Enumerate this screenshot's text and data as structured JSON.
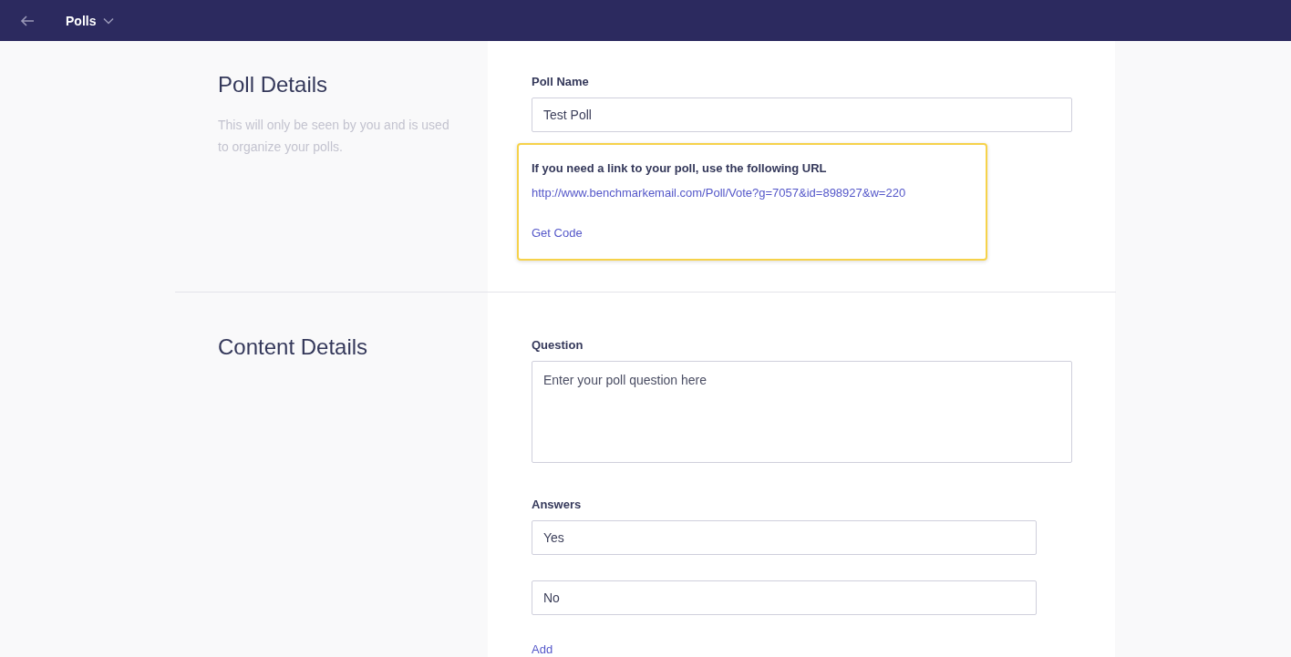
{
  "header": {
    "title": "Polls"
  },
  "poll_details": {
    "title": "Poll Details",
    "description": "This will only be seen by you and is used to organize your polls.",
    "poll_name": {
      "label": "Poll Name",
      "value": "Test Poll"
    },
    "link_box": {
      "text": "If you need a link to your poll, use the following URL",
      "url": "http://www.benchmarkemail.com/Poll/Vote?g=7057&id=898927&w=220",
      "get_code": "Get Code"
    }
  },
  "content_details": {
    "title": "Content Details",
    "question": {
      "label": "Question",
      "placeholder": "Enter your poll question here"
    },
    "answers_label": "Answers",
    "answers": [
      {
        "value": "Yes"
      },
      {
        "value": "No"
      }
    ],
    "add": "Add"
  }
}
